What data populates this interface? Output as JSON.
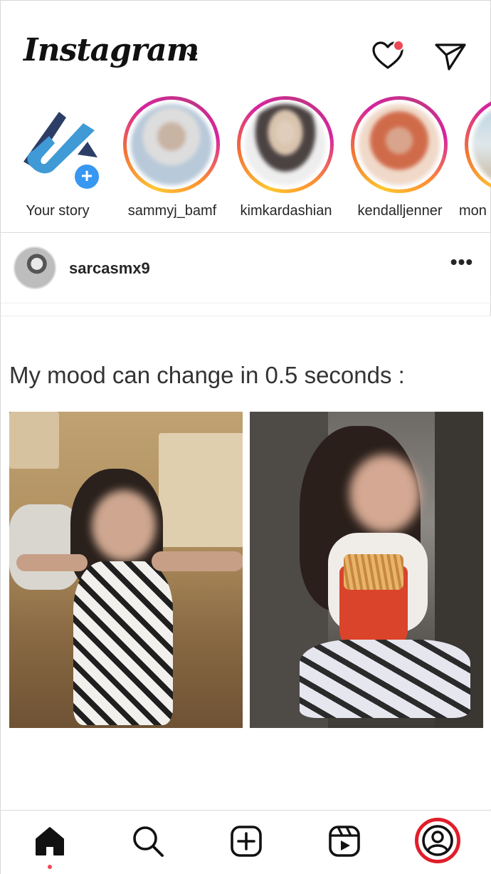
{
  "header": {
    "logo": "Instagram",
    "icons": [
      "chevron-down-icon",
      "heart-icon",
      "send-icon"
    ],
    "notification_color": "#ed4956"
  },
  "stories": [
    {
      "label": "Your story"
    },
    {
      "label": "sammyj_bamf"
    },
    {
      "label": "kimkardashian"
    },
    {
      "label": "kendalljenner"
    },
    {
      "label": "mon"
    }
  ],
  "post": {
    "username": "sarcasmx9",
    "more": "•••",
    "caption": "My mood can change in 0.5 seconds :"
  },
  "bottom_nav": {
    "items": [
      "home-icon",
      "search-icon",
      "new-post-icon",
      "reels-icon",
      "profile-icon"
    ],
    "active": "home",
    "highlight_color": "#e11d2a"
  }
}
